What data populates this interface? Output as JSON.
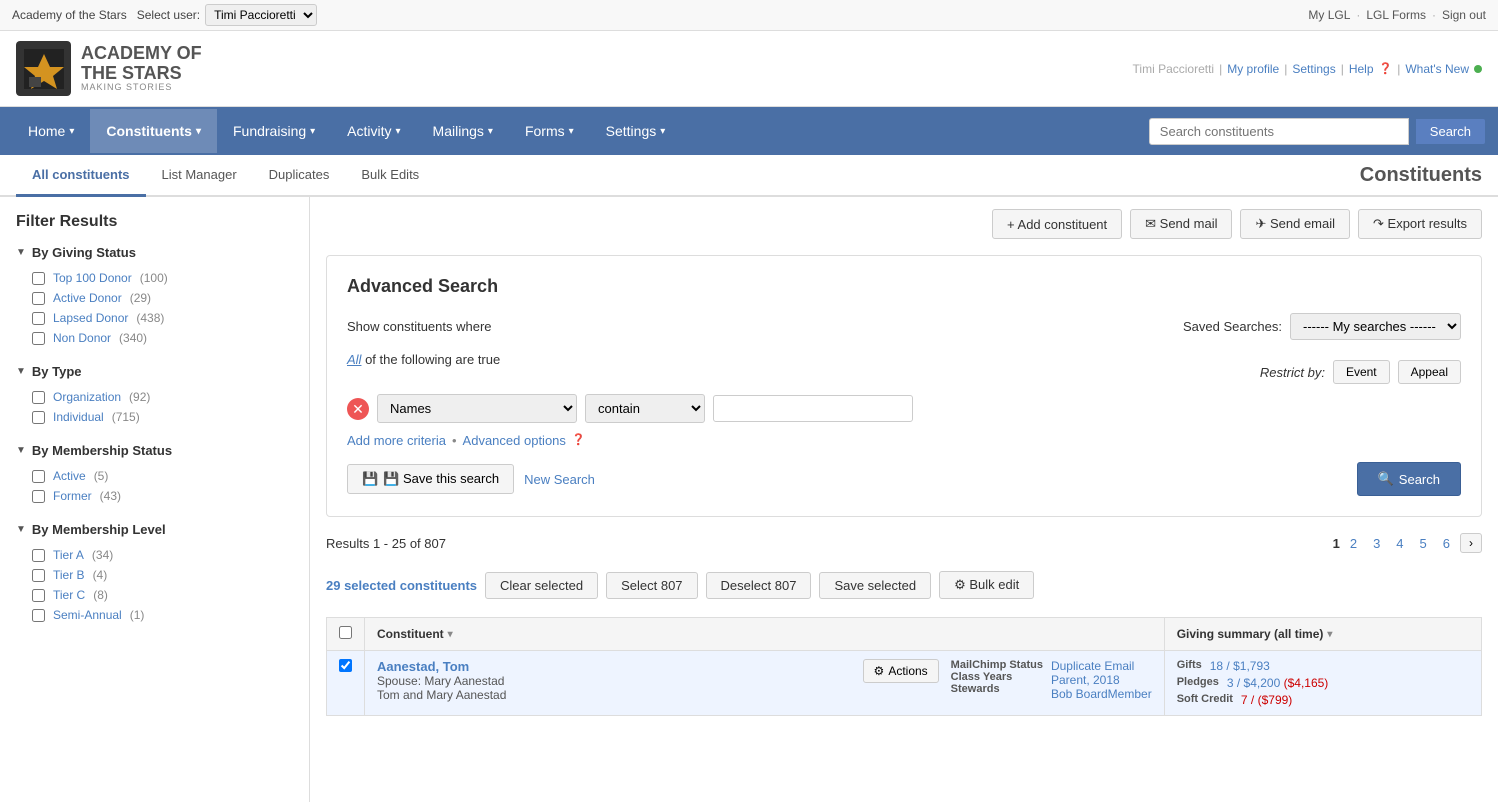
{
  "top_bar": {
    "org_name": "Academy of the Stars",
    "select_user_label": "Select user:",
    "current_user": "Timi Paccioretti",
    "right_links": [
      "My LGL",
      "LGL Forms",
      "Sign out"
    ]
  },
  "header": {
    "logo_org_name": "ACADEMY OF",
    "logo_org_name2": "THE STARS",
    "logo_tagline": "MAKING STORIES",
    "user_name": "Timi Paccioretti",
    "user_links": [
      "My profile",
      "Settings",
      "Help",
      "What's New"
    ]
  },
  "nav": {
    "items": [
      {
        "label": "Home",
        "has_dropdown": true,
        "active": false
      },
      {
        "label": "Constituents",
        "has_dropdown": true,
        "active": true
      },
      {
        "label": "Fundraising",
        "has_dropdown": true,
        "active": false
      },
      {
        "label": "Activity",
        "has_dropdown": true,
        "active": false
      },
      {
        "label": "Mailings",
        "has_dropdown": true,
        "active": false
      },
      {
        "label": "Forms",
        "has_dropdown": true,
        "active": false
      },
      {
        "label": "Settings",
        "has_dropdown": true,
        "active": false
      }
    ],
    "search_placeholder": "Search constituents",
    "search_button": "Search"
  },
  "sub_nav": {
    "tabs": [
      {
        "label": "All constituents",
        "active": true
      },
      {
        "label": "List Manager",
        "active": false
      },
      {
        "label": "Duplicates",
        "active": false
      },
      {
        "label": "Bulk Edits",
        "active": false
      }
    ],
    "page_title": "Constituents"
  },
  "action_buttons": [
    {
      "label": "+ Add constituent",
      "type": "default"
    },
    {
      "label": "✉ Send mail",
      "type": "default"
    },
    {
      "label": "✈ Send email",
      "type": "default"
    },
    {
      "label": "↷ Export results",
      "type": "default"
    }
  ],
  "sidebar": {
    "title": "Filter Results",
    "sections": [
      {
        "title": "By Giving Status",
        "items": [
          {
            "label": "Top 100 Donor",
            "count": "(100)"
          },
          {
            "label": "Active Donor",
            "count": "(29)"
          },
          {
            "label": "Lapsed Donor",
            "count": "(438)"
          },
          {
            "label": "Non Donor",
            "count": "(340)"
          }
        ]
      },
      {
        "title": "By Type",
        "items": [
          {
            "label": "Organization",
            "count": "(92)"
          },
          {
            "label": "Individual",
            "count": "(715)"
          }
        ]
      },
      {
        "title": "By Membership Status",
        "items": [
          {
            "label": "Active",
            "count": "(5)"
          },
          {
            "label": "Former",
            "count": "(43)"
          }
        ]
      },
      {
        "title": "By Membership Level",
        "items": [
          {
            "label": "Tier A",
            "count": "(34)"
          },
          {
            "label": "Tier B",
            "count": "(4)"
          },
          {
            "label": "Tier C",
            "count": "(8)"
          },
          {
            "label": "Semi-Annual",
            "count": "(1)"
          }
        ]
      }
    ]
  },
  "advanced_search": {
    "title": "Advanced Search",
    "show_label": "Show constituents where",
    "all_label": "All",
    "condition_label": "of the following are true",
    "saved_searches_label": "Saved Searches:",
    "saved_searches_default": "------ My searches ------",
    "restrict_by_label": "Restrict by:",
    "restrict_event": "Event",
    "restrict_appeal": "Appeal",
    "criteria_field": "Names",
    "criteria_operator": "contain",
    "criteria_value": "",
    "add_criteria": "Add more criteria",
    "advanced_options": "Advanced options",
    "save_search_label": "💾 Save this search",
    "new_search_label": "New Search",
    "search_button": "🔍 Search"
  },
  "results": {
    "results_label": "Results 1 - 25 of 807",
    "pagination": [
      "1",
      "2",
      "3",
      "4",
      "5",
      "6"
    ],
    "current_page": "1",
    "selected_count": "29 selected constituents",
    "clear_selected": "Clear selected",
    "select_807": "Select 807",
    "deselect_807": "Deselect 807",
    "save_selected": "Save selected",
    "bulk_edit": "⚙ Bulk edit",
    "table": {
      "headers": [
        "Constituent",
        "Giving summary (all time)"
      ],
      "rows": [
        {
          "selected": true,
          "name": "Aanestad, Tom",
          "spouse": "Spouse: Mary Aanestad",
          "note": "Tom and Mary Aanestad",
          "actions_label": "⚙ Actions",
          "meta": [
            {
              "label": "MailChimp Status",
              "value": ""
            },
            {
              "label": "Class Years",
              "value": ""
            }
          ],
          "meta_links": [
            "Duplicate Email",
            "Parent, 2018",
            "Bob BoardMember"
          ],
          "giving": {
            "gifts_label": "Gifts",
            "gifts_value": "18 / $1,793",
            "pledges_label": "Pledges",
            "pledges_value": "3 / $4,200 ($4,165)",
            "soft_credit_label": "Soft Credit",
            "soft_credit_value": "7 / ($799)"
          }
        }
      ]
    }
  }
}
